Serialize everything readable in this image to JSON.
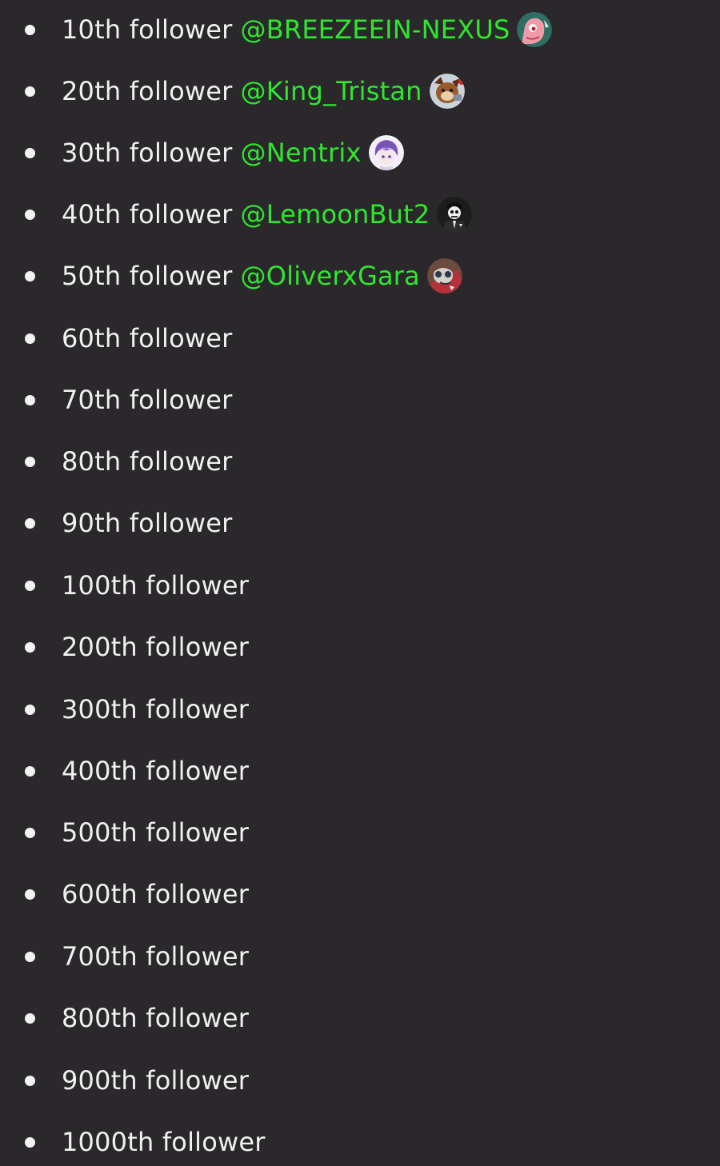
{
  "milestones": [
    {
      "label": "10th follower",
      "mention": "@BREEZEEIN-NEXUS",
      "avatar": "pink-character-avatar"
    },
    {
      "label": "20th follower",
      "mention": "@King_Tristan",
      "avatar": "brown-character-avatar"
    },
    {
      "label": "30th follower",
      "mention": "@Nentrix",
      "avatar": "purple-hair-avatar"
    },
    {
      "label": "40th follower",
      "mention": "@LemoonBut2",
      "avatar": "skull-avatar"
    },
    {
      "label": "50th follower",
      "mention": "@OliverxGara",
      "avatar": "goggles-avatar"
    },
    {
      "label": "60th follower"
    },
    {
      "label": "70th follower"
    },
    {
      "label": "80th follower"
    },
    {
      "label": "90th follower"
    },
    {
      "label": "100th follower"
    },
    {
      "label": "200th follower"
    },
    {
      "label": "300th follower"
    },
    {
      "label": "400th follower"
    },
    {
      "label": "500th follower"
    },
    {
      "label": "600th follower"
    },
    {
      "label": "700th follower"
    },
    {
      "label": "800th follower"
    },
    {
      "label": "900th follower"
    },
    {
      "label": "1000th follower"
    }
  ],
  "colors": {
    "background": "#2b282c",
    "text": "#f1f1f1",
    "mention": "#2fe62f"
  }
}
